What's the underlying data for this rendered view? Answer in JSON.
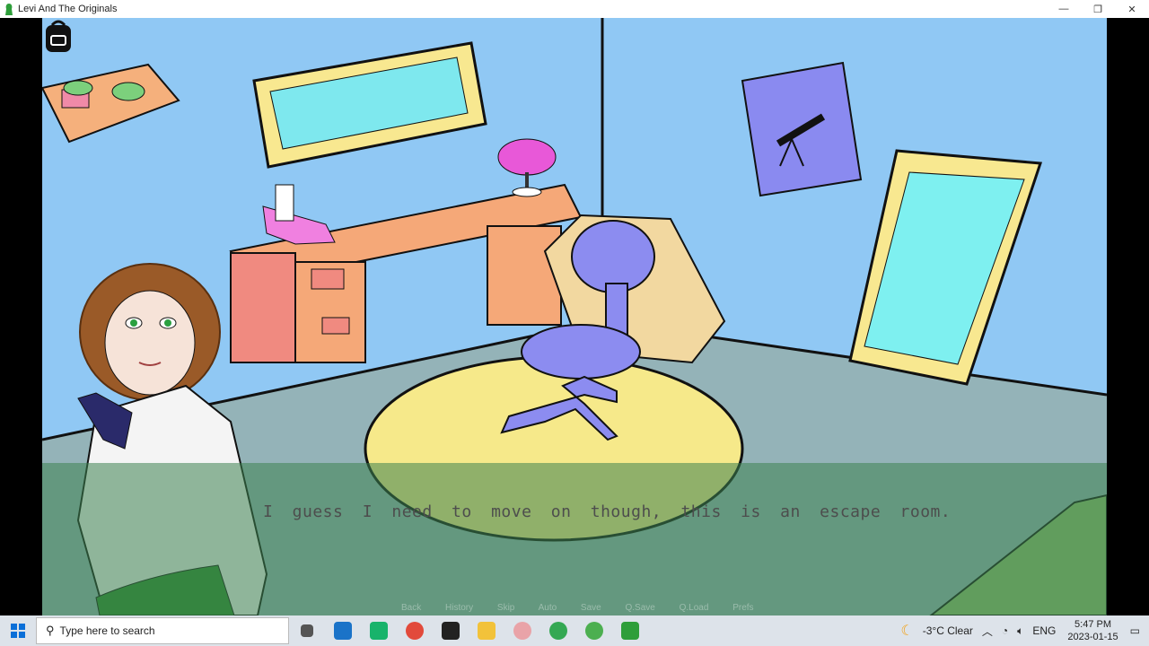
{
  "window": {
    "title": "Levi And The Originals",
    "minimize": "—",
    "restore": "❐",
    "close": "✕"
  },
  "game": {
    "dialogue": "I guess I need to move on though, this is an escape room.",
    "quick_menu": "Back History Skip Auto Save Q.Save Q.Load Prefs"
  },
  "taskbar": {
    "search_placeholder": "Type here to search",
    "weather": "-3°C  Clear",
    "language": "ENG",
    "time": "5:47 PM",
    "date": "2023-01-15",
    "apps": [
      {
        "name": "task-view",
        "color": "#555"
      },
      {
        "name": "mail",
        "color": "#1a73c8"
      },
      {
        "name": "app-green",
        "color": "#18b36b"
      },
      {
        "name": "chrome",
        "color": "#e24a3b"
      },
      {
        "name": "unity",
        "color": "#222"
      },
      {
        "name": "file-explorer",
        "color": "#f2c23a"
      },
      {
        "name": "game-character",
        "color": "#e9a3a8"
      },
      {
        "name": "chrome-2",
        "color": "#34a853"
      },
      {
        "name": "atom",
        "color": "#4caf50"
      },
      {
        "name": "levi-game",
        "color": "#2e9e3a"
      }
    ]
  },
  "colors": {
    "wall": "#90c8f4",
    "floor": "#94b3b8",
    "rug": "#f6e98a",
    "desk": "#f5a878",
    "chair": "#8c8cf0",
    "dialog_bg": "#3c8250"
  }
}
